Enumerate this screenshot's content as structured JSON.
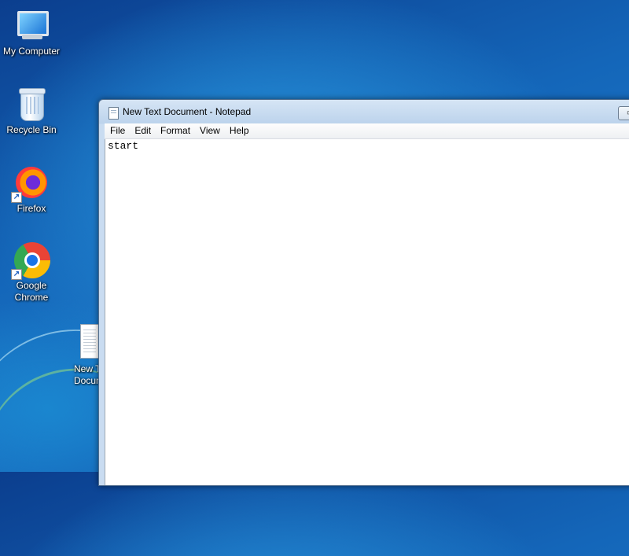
{
  "desktop": {
    "icons": [
      {
        "label": "My Computer",
        "icon": "computer-icon"
      },
      {
        "label": "Recycle Bin",
        "icon": "recycle-bin-icon"
      },
      {
        "label": "Firefox",
        "icon": "firefox-icon"
      },
      {
        "label": "Google\nChrome",
        "icon": "chrome-icon"
      },
      {
        "label": "New T\nDocum",
        "icon": "text-document-icon"
      }
    ]
  },
  "notepad": {
    "title": "New Text Document - Notepad",
    "menu": [
      "File",
      "Edit",
      "Format",
      "View",
      "Help"
    ],
    "content": "start"
  },
  "colors": {
    "desktop_blue": "#1a73c4",
    "titlebar": "#c9dcf1",
    "editor_bg": "#ffffff"
  }
}
